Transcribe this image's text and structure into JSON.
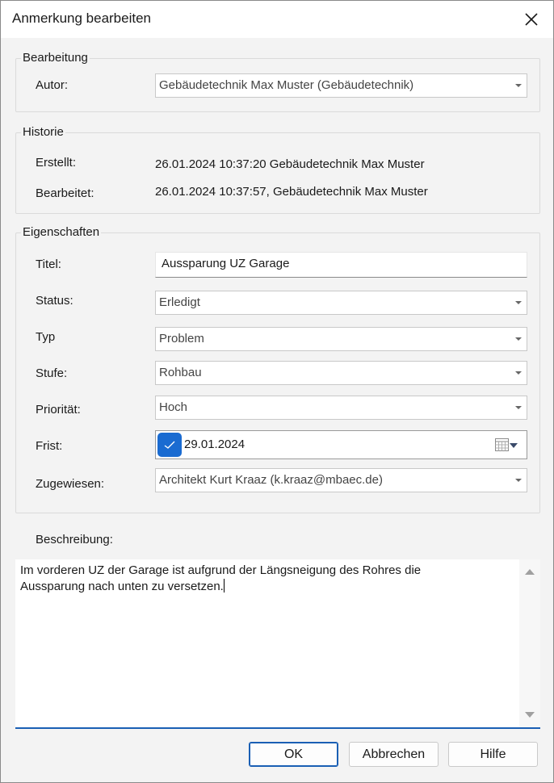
{
  "window": {
    "title": "Anmerkung bearbeiten"
  },
  "bearbeitung": {
    "group_label": "Bearbeitung",
    "autor_label": "Autor:",
    "autor_value": "Gebäudetechnik Max Muster (Gebäudetechnik)"
  },
  "historie": {
    "group_label": "Historie",
    "erstellt_label": "Erstellt:",
    "erstellt_value": "26.01.2024 10:37:20 Gebäudetechnik Max Muster",
    "bearbeitet_label": "Bearbeitet:",
    "bearbeitet_value": "26.01.2024 10:37:57, Gebäudetechnik Max Muster"
  },
  "eigenschaften": {
    "group_label": "Eigenschaften",
    "titel_label": "Titel:",
    "titel_value": "Aussparung UZ Garage",
    "status_label": "Status:",
    "status_value": "Erledigt",
    "typ_label": "Typ",
    "typ_value": "Problem",
    "stufe_label": "Stufe:",
    "stufe_value": "Rohbau",
    "prioritaet_label": "Priorität:",
    "prioritaet_value": "Hoch",
    "frist_label": "Frist:",
    "frist_value": "29.01.2024",
    "frist_checked": true,
    "zugewiesen_label": "Zugewiesen:",
    "zugewiesen_value": "Architekt Kurt Kraaz (k.kraaz@mbaec.de)"
  },
  "beschreibung": {
    "label": "Beschreibung:",
    "line1": "Im vorderen UZ der Garage ist aufgrund der Längsneigung des Rohres die",
    "line2": "Aussparung nach unten zu versetzen."
  },
  "buttons": {
    "ok": "OK",
    "cancel": "Abbrechen",
    "help": "Hilfe"
  },
  "icons": {
    "close": "close-icon",
    "dropdown": "chevron-down-icon",
    "checkbox": "check-icon",
    "calendar": "calendar-icon"
  },
  "colors": {
    "accent": "#1a6bd1",
    "focus_underline": "#1a5fb4",
    "background": "#f3f3f3"
  }
}
